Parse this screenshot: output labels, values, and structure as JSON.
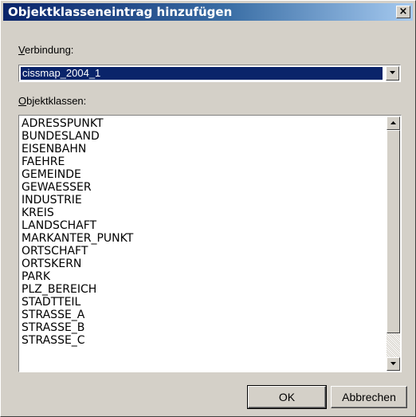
{
  "window": {
    "title": "Objektklasseneintrag hinzufügen",
    "close_glyph": "×"
  },
  "connection": {
    "label_accel": "V",
    "label_rest": "erbindung:",
    "selected_value": "cissmap_2004_1"
  },
  "classes": {
    "label_accel": "O",
    "label_rest": "bjektklassen:",
    "items": [
      "ADRESSPUNKT",
      "BUNDESLAND",
      "EISENBAHN",
      "FAEHRE",
      "GEMEINDE",
      "GEWAESSER",
      "INDUSTRIE",
      "KREIS",
      "LANDSCHAFT",
      "MARKANTER_PUNKT",
      "ORTSCHAFT",
      "ORTSKERN",
      "PARK",
      "PLZ_BEREICH",
      "STADTTEIL",
      "STRASSE_A",
      "STRASSE_B",
      "STRASSE_C"
    ]
  },
  "buttons": {
    "ok_label": "OK",
    "cancel_label": "Abbrechen"
  },
  "icons": {
    "close": "close-icon",
    "combo_arrow": "chevron-down-icon",
    "scroll_up": "chevron-up-icon",
    "scroll_down": "chevron-down-icon"
  },
  "colors": {
    "titlebar_start": "#0a246a",
    "titlebar_end": "#a6caf0",
    "selection": "#0a246a",
    "face": "#d4d0c8"
  }
}
